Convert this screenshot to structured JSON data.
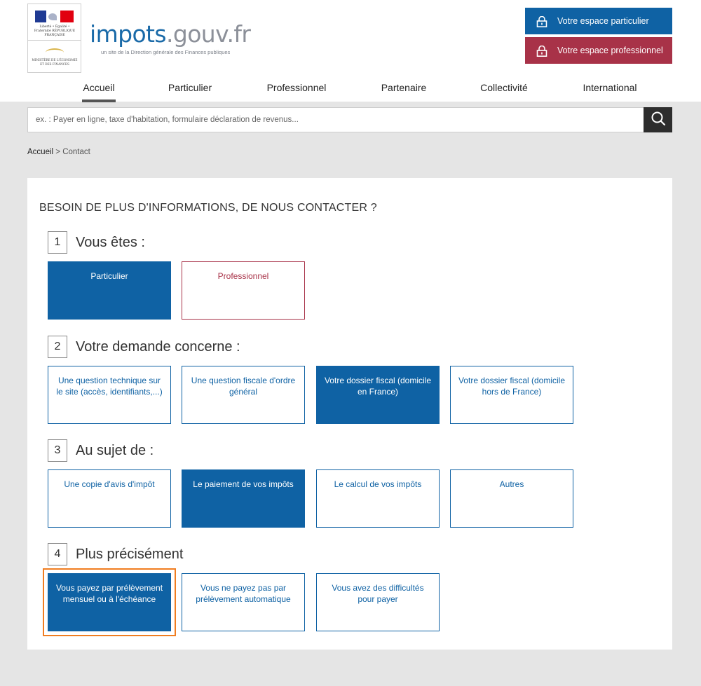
{
  "header": {
    "logo_motto": "Liberté • Égalité • Fraternité RÉPUBLIQUE FRANÇAISE",
    "ministry_text": "MINISTÈRE DE L'ÉCONOMIE ET DES FINANCES",
    "brand_part1": "impots",
    "brand_part2": ".gouv.fr",
    "brand_subtitle": "un site de la Direction générale des Finances publiques",
    "espace_particulier": "Votre espace particulier",
    "espace_professionnel": "Votre espace professionnel",
    "colors": {
      "particulier": "#0f62a4",
      "professionnel": "#a83248"
    }
  },
  "nav": {
    "items": [
      "Accueil",
      "Particulier",
      "Professionnel",
      "Partenaire",
      "Collectivité",
      "International"
    ],
    "active": "Accueil"
  },
  "search": {
    "placeholder": "ex. : Payer en ligne, taxe d'habitation, formulaire déclaration de revenus...",
    "icon": "search-icon"
  },
  "breadcrumb": {
    "home": "Accueil",
    "separator": " > ",
    "current": "Contact"
  },
  "contact": {
    "title": "BESOIN DE PLUS D'INFORMATIONS, DE NOUS CONTACTER ?",
    "steps": [
      {
        "number": "1",
        "label": "Vous êtes :",
        "options": [
          "Particulier",
          "Professionnel"
        ],
        "selected": "Particulier"
      },
      {
        "number": "2",
        "label": "Votre demande concerne :",
        "options": [
          "Une question technique sur le site (accès, identifiants,...)",
          "Une question fiscale d'ordre général",
          "Votre dossier fiscal (domicile en France)",
          "Votre dossier fiscal (domicile hors de France)"
        ],
        "selected": "Votre dossier fiscal (domicile en France)"
      },
      {
        "number": "3",
        "label": "Au sujet de :",
        "options": [
          "Une copie d'avis d'impôt",
          "Le paiement de vos impôts",
          "Le calcul de vos impôts",
          "Autres"
        ],
        "selected": "Le paiement de vos impôts"
      },
      {
        "number": "4",
        "label": "Plus précisément",
        "options": [
          "Vous payez par prélèvement mensuel ou à l'échéance",
          "Vous ne payez pas par prélèvement automatique",
          "Vous avez des difficultés pour payer"
        ],
        "selected": "Vous payez par prélèvement mensuel ou à l'échéance"
      }
    ],
    "focus_color": "#f07d20"
  }
}
